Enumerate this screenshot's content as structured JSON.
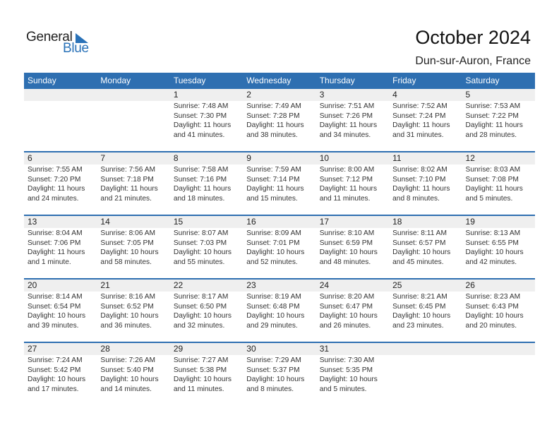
{
  "logo": {
    "general": "General",
    "blue": "Blue"
  },
  "title": "October 2024",
  "subtitle": "Dun-sur-Auron, France",
  "colors": {
    "accent": "#2e6fb1",
    "day_bar": "#efefef"
  },
  "weekdays": [
    "Sunday",
    "Monday",
    "Tuesday",
    "Wednesday",
    "Thursday",
    "Friday",
    "Saturday"
  ],
  "weeks": [
    [
      {
        "day": "",
        "sunrise": "",
        "sunset": "",
        "daylight": "",
        "minutes": ""
      },
      {
        "day": "",
        "sunrise": "",
        "sunset": "",
        "daylight": "",
        "minutes": ""
      },
      {
        "day": "1",
        "sunrise": "Sunrise: 7:48 AM",
        "sunset": "Sunset: 7:30 PM",
        "daylight": "Daylight: 11 hours",
        "minutes": "and 41 minutes."
      },
      {
        "day": "2",
        "sunrise": "Sunrise: 7:49 AM",
        "sunset": "Sunset: 7:28 PM",
        "daylight": "Daylight: 11 hours",
        "minutes": "and 38 minutes."
      },
      {
        "day": "3",
        "sunrise": "Sunrise: 7:51 AM",
        "sunset": "Sunset: 7:26 PM",
        "daylight": "Daylight: 11 hours",
        "minutes": "and 34 minutes."
      },
      {
        "day": "4",
        "sunrise": "Sunrise: 7:52 AM",
        "sunset": "Sunset: 7:24 PM",
        "daylight": "Daylight: 11 hours",
        "minutes": "and 31 minutes."
      },
      {
        "day": "5",
        "sunrise": "Sunrise: 7:53 AM",
        "sunset": "Sunset: 7:22 PM",
        "daylight": "Daylight: 11 hours",
        "minutes": "and 28 minutes."
      }
    ],
    [
      {
        "day": "6",
        "sunrise": "Sunrise: 7:55 AM",
        "sunset": "Sunset: 7:20 PM",
        "daylight": "Daylight: 11 hours",
        "minutes": "and 24 minutes."
      },
      {
        "day": "7",
        "sunrise": "Sunrise: 7:56 AM",
        "sunset": "Sunset: 7:18 PM",
        "daylight": "Daylight: 11 hours",
        "minutes": "and 21 minutes."
      },
      {
        "day": "8",
        "sunrise": "Sunrise: 7:58 AM",
        "sunset": "Sunset: 7:16 PM",
        "daylight": "Daylight: 11 hours",
        "minutes": "and 18 minutes."
      },
      {
        "day": "9",
        "sunrise": "Sunrise: 7:59 AM",
        "sunset": "Sunset: 7:14 PM",
        "daylight": "Daylight: 11 hours",
        "minutes": "and 15 minutes."
      },
      {
        "day": "10",
        "sunrise": "Sunrise: 8:00 AM",
        "sunset": "Sunset: 7:12 PM",
        "daylight": "Daylight: 11 hours",
        "minutes": "and 11 minutes."
      },
      {
        "day": "11",
        "sunrise": "Sunrise: 8:02 AM",
        "sunset": "Sunset: 7:10 PM",
        "daylight": "Daylight: 11 hours",
        "minutes": "and 8 minutes."
      },
      {
        "day": "12",
        "sunrise": "Sunrise: 8:03 AM",
        "sunset": "Sunset: 7:08 PM",
        "daylight": "Daylight: 11 hours",
        "minutes": "and 5 minutes."
      }
    ],
    [
      {
        "day": "13",
        "sunrise": "Sunrise: 8:04 AM",
        "sunset": "Sunset: 7:06 PM",
        "daylight": "Daylight: 11 hours",
        "minutes": "and 1 minute."
      },
      {
        "day": "14",
        "sunrise": "Sunrise: 8:06 AM",
        "sunset": "Sunset: 7:05 PM",
        "daylight": "Daylight: 10 hours",
        "minutes": "and 58 minutes."
      },
      {
        "day": "15",
        "sunrise": "Sunrise: 8:07 AM",
        "sunset": "Sunset: 7:03 PM",
        "daylight": "Daylight: 10 hours",
        "minutes": "and 55 minutes."
      },
      {
        "day": "16",
        "sunrise": "Sunrise: 8:09 AM",
        "sunset": "Sunset: 7:01 PM",
        "daylight": "Daylight: 10 hours",
        "minutes": "and 52 minutes."
      },
      {
        "day": "17",
        "sunrise": "Sunrise: 8:10 AM",
        "sunset": "Sunset: 6:59 PM",
        "daylight": "Daylight: 10 hours",
        "minutes": "and 48 minutes."
      },
      {
        "day": "18",
        "sunrise": "Sunrise: 8:11 AM",
        "sunset": "Sunset: 6:57 PM",
        "daylight": "Daylight: 10 hours",
        "minutes": "and 45 minutes."
      },
      {
        "day": "19",
        "sunrise": "Sunrise: 8:13 AM",
        "sunset": "Sunset: 6:55 PM",
        "daylight": "Daylight: 10 hours",
        "minutes": "and 42 minutes."
      }
    ],
    [
      {
        "day": "20",
        "sunrise": "Sunrise: 8:14 AM",
        "sunset": "Sunset: 6:54 PM",
        "daylight": "Daylight: 10 hours",
        "minutes": "and 39 minutes."
      },
      {
        "day": "21",
        "sunrise": "Sunrise: 8:16 AM",
        "sunset": "Sunset: 6:52 PM",
        "daylight": "Daylight: 10 hours",
        "minutes": "and 36 minutes."
      },
      {
        "day": "22",
        "sunrise": "Sunrise: 8:17 AM",
        "sunset": "Sunset: 6:50 PM",
        "daylight": "Daylight: 10 hours",
        "minutes": "and 32 minutes."
      },
      {
        "day": "23",
        "sunrise": "Sunrise: 8:19 AM",
        "sunset": "Sunset: 6:48 PM",
        "daylight": "Daylight: 10 hours",
        "minutes": "and 29 minutes."
      },
      {
        "day": "24",
        "sunrise": "Sunrise: 8:20 AM",
        "sunset": "Sunset: 6:47 PM",
        "daylight": "Daylight: 10 hours",
        "minutes": "and 26 minutes."
      },
      {
        "day": "25",
        "sunrise": "Sunrise: 8:21 AM",
        "sunset": "Sunset: 6:45 PM",
        "daylight": "Daylight: 10 hours",
        "minutes": "and 23 minutes."
      },
      {
        "day": "26",
        "sunrise": "Sunrise: 8:23 AM",
        "sunset": "Sunset: 6:43 PM",
        "daylight": "Daylight: 10 hours",
        "minutes": "and 20 minutes."
      }
    ],
    [
      {
        "day": "27",
        "sunrise": "Sunrise: 7:24 AM",
        "sunset": "Sunset: 5:42 PM",
        "daylight": "Daylight: 10 hours",
        "minutes": "and 17 minutes."
      },
      {
        "day": "28",
        "sunrise": "Sunrise: 7:26 AM",
        "sunset": "Sunset: 5:40 PM",
        "daylight": "Daylight: 10 hours",
        "minutes": "and 14 minutes."
      },
      {
        "day": "29",
        "sunrise": "Sunrise: 7:27 AM",
        "sunset": "Sunset: 5:38 PM",
        "daylight": "Daylight: 10 hours",
        "minutes": "and 11 minutes."
      },
      {
        "day": "30",
        "sunrise": "Sunrise: 7:29 AM",
        "sunset": "Sunset: 5:37 PM",
        "daylight": "Daylight: 10 hours",
        "minutes": "and 8 minutes."
      },
      {
        "day": "31",
        "sunrise": "Sunrise: 7:30 AM",
        "sunset": "Sunset: 5:35 PM",
        "daylight": "Daylight: 10 hours",
        "minutes": "and 5 minutes."
      },
      {
        "day": "",
        "sunrise": "",
        "sunset": "",
        "daylight": "",
        "minutes": ""
      },
      {
        "day": "",
        "sunrise": "",
        "sunset": "",
        "daylight": "",
        "minutes": ""
      }
    ]
  ]
}
